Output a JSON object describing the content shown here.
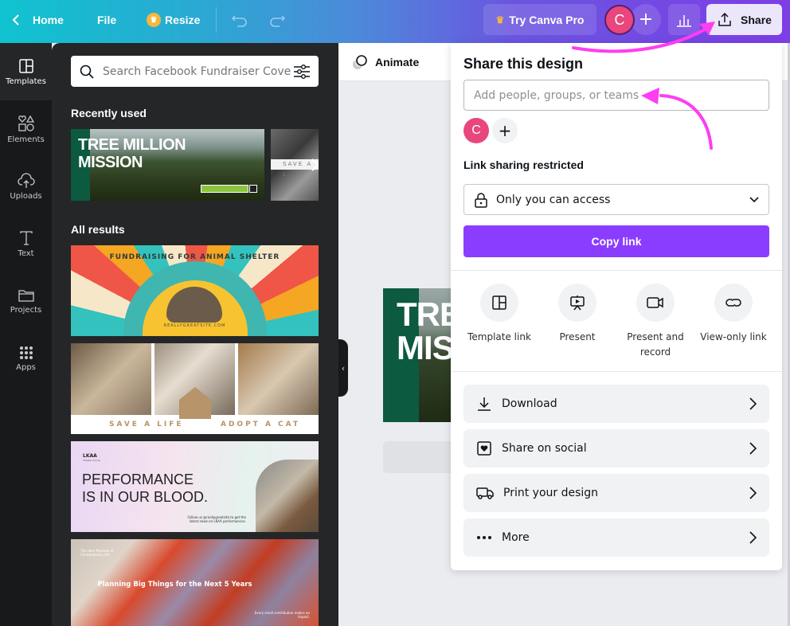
{
  "topbar": {
    "home_label": "Home",
    "file_label": "File",
    "resize_label": "Resize",
    "try_pro_label": "Try Canva Pro",
    "avatar_initial": "C",
    "share_label": "Share"
  },
  "rail": {
    "items": [
      {
        "label": "Templates",
        "icon": "template-icon",
        "active": true
      },
      {
        "label": "Elements",
        "icon": "shapes-icon"
      },
      {
        "label": "Uploads",
        "icon": "cloud-upload-icon"
      },
      {
        "label": "Text",
        "icon": "text-icon"
      },
      {
        "label": "Projects",
        "icon": "folder-icon"
      },
      {
        "label": "Apps",
        "icon": "apps-grid-icon"
      }
    ]
  },
  "panel": {
    "search_placeholder": "Search Facebook Fundraiser Cove",
    "recently_used_title": "Recently used",
    "all_results_title": "All results",
    "recent": [
      {
        "line1": "TREE MILLION",
        "line2": "MISSION"
      },
      {
        "text": "SAVE A L"
      }
    ],
    "results": [
      {
        "title": "FUNDRAISING FOR ANIMAL SHELTER",
        "site": "REALLYGREATSITE.COM"
      },
      {
        "left": "SAVE A LIFE",
        "right": "ADOPT A CAT"
      },
      {
        "brand": "LKAA",
        "brand_sub": "Theater Group",
        "line1": "PERFORMANCE",
        "line2": "IS IN OUR BLOOD.",
        "footer1": "Follow us @reallygreatsite to get the",
        "footer2": "latest news on LKAA performances."
      },
      {
        "brand": "The Haro Museum of Contemporary Art",
        "headline": "Planning Big Things for the Next 5 Years",
        "footer": "Every small contribution makes an impact."
      }
    ]
  },
  "canvas": {
    "animate_label": "Animate",
    "design_line1": "TRE",
    "design_line2": "MIS"
  },
  "share": {
    "title": "Share this design",
    "input_placeholder": "Add people, groups, or teams",
    "member_initial": "C",
    "link_label": "Link sharing restricted",
    "access_value": "Only you can access",
    "copy_link_label": "Copy link",
    "options": [
      {
        "label": "Template link",
        "icon": "template-icon"
      },
      {
        "label": "Present",
        "icon": "presentation-icon"
      },
      {
        "label": "Present and record",
        "icon": "video-camera-icon"
      },
      {
        "label": "View-only link",
        "icon": "link-icon"
      }
    ],
    "rows": [
      {
        "label": "Download",
        "icon": "download-icon"
      },
      {
        "label": "Share on social",
        "icon": "heart-square-icon"
      },
      {
        "label": "Print your design",
        "icon": "truck-icon"
      },
      {
        "label": "More",
        "icon": "more-dots-icon"
      }
    ]
  },
  "colors": {
    "accent_purple": "#8b3dff",
    "avatar_pink": "#e8467c",
    "annotation_magenta": "#ff3df2"
  }
}
